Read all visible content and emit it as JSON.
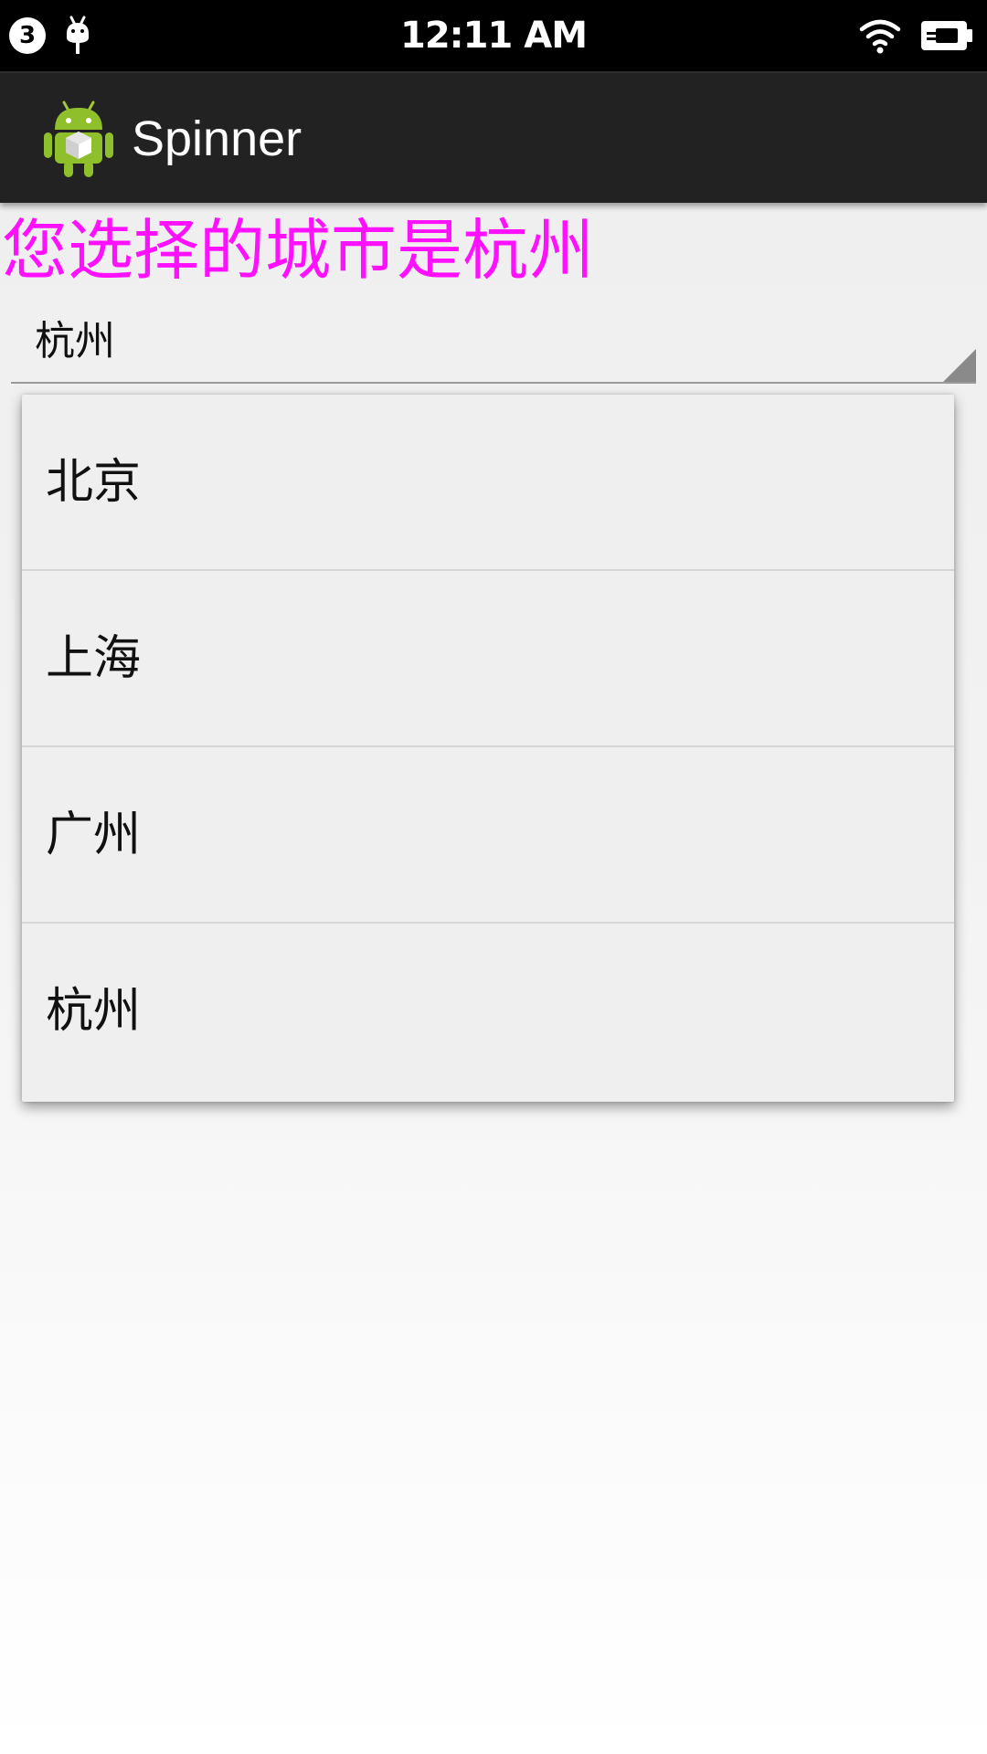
{
  "status_bar": {
    "notification_count": "3",
    "time": "12:11 AM",
    "icons": [
      "android-debug-icon",
      "wifi-icon",
      "battery-charging-icon"
    ]
  },
  "action_bar": {
    "title": "Spinner",
    "icon": "android-app-icon"
  },
  "result_text": "您选择的城市是杭州",
  "spinner": {
    "selected": "杭州"
  },
  "dropdown": {
    "items": [
      {
        "label": "北京"
      },
      {
        "label": "上海"
      },
      {
        "label": "广州"
      },
      {
        "label": "杭州"
      }
    ]
  },
  "colors": {
    "result_text": "#ff10ff",
    "action_bar": "#222222",
    "status_bar": "#000000"
  }
}
